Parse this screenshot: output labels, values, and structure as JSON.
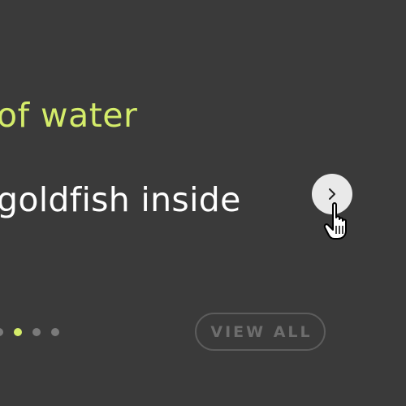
{
  "carousel": {
    "headline": "of water",
    "subline": "goldfish inside",
    "next_button_icon": "chevron-right-icon",
    "pagination": {
      "total_visible_dots": 4,
      "active_index": 1
    },
    "view_all_label": "VIEW ALL"
  },
  "colors": {
    "background": "#3a3a3a",
    "accent": "#d4ec6a",
    "text": "#ffffff",
    "button_fill": "#e9e9e9",
    "muted": "#6d6d6d"
  },
  "cursor_icon": "hand-pointer-icon"
}
